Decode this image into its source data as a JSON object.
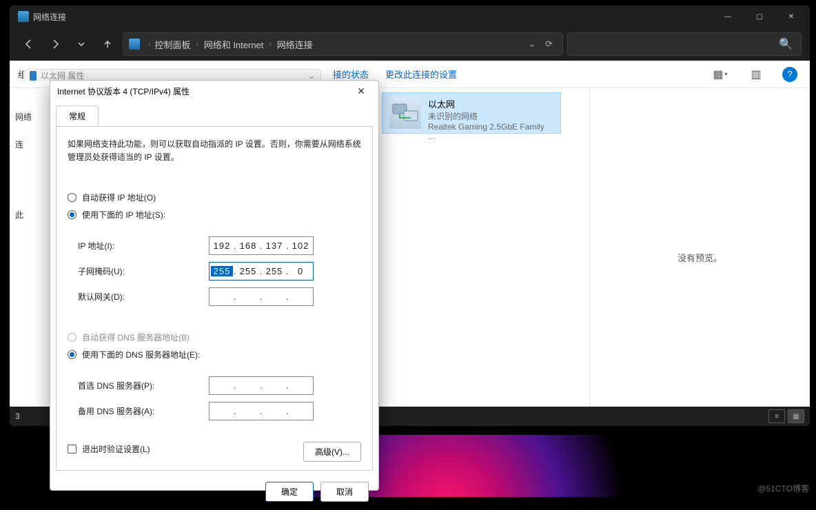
{
  "window": {
    "title": "网络连接",
    "min": "—",
    "max": "▢",
    "close": "✕"
  },
  "address": {
    "crumbs": [
      "控制面板",
      "网络和 Internet",
      "网络连接"
    ],
    "dropdown": "⌄",
    "refresh": "⟳"
  },
  "search": {
    "icon": "🔍"
  },
  "cmdbar": {
    "left_trunc_prefix": "组",
    "status_link": "接的状态",
    "settings_link": "更改此连接的设置",
    "view_icon": "▦",
    "details_icon": "▥",
    "help_icon": "?"
  },
  "content": {
    "left_col": {
      "network": "网络",
      "conn": "连",
      "here": "此"
    },
    "netitem": {
      "name": "以太网",
      "status": "未识别的网络",
      "adapter": "Realtek Gaming 2.5GbE Family ..."
    },
    "preview": "没有预览。"
  },
  "statusbar": {
    "count": "3"
  },
  "propstrip": {
    "text": "以太网 属性",
    "dd": "⌄"
  },
  "dialog": {
    "title": "Internet 协议版本 4 (TCP/IPv4) 属性",
    "tab_general": "常规",
    "desc": "如果网络支持此功能，则可以获取自动指派的 IP 设置。否则，你需要从网络系统管理员处获得适当的 IP 设置。",
    "r_auto_ip": "自动获得 IP 地址(O)",
    "r_manual_ip": "使用下面的 IP 地址(S):",
    "l_ip": "IP 地址(I):",
    "l_mask": "子网掩码(U):",
    "l_gw": "默认网关(D):",
    "ip": {
      "o1": "192",
      "o2": "168",
      "o3": "137",
      "o4": "102"
    },
    "mask": {
      "o1": "255",
      "o2": "255",
      "o3": "255",
      "o4": "0"
    },
    "gw": {
      "o1": "",
      "o2": "",
      "o3": "",
      "o4": ""
    },
    "r_auto_dns": "自动获得 DNS 服务器地址(B)",
    "r_manual_dns": "使用下面的 DNS 服务器地址(E):",
    "l_dns1": "首选 DNS 服务器(P):",
    "l_dns2": "备用 DNS 服务器(A):",
    "dns1": {
      "o1": "",
      "o2": "",
      "o3": "",
      "o4": ""
    },
    "dns2": {
      "o1": "",
      "o2": "",
      "o3": "",
      "o4": ""
    },
    "chk_validate": "退出时验证设置(L)",
    "advanced": "高级(V)...",
    "ok": "确定",
    "cancel": "取消"
  },
  "watermark": "@51CTO博客"
}
